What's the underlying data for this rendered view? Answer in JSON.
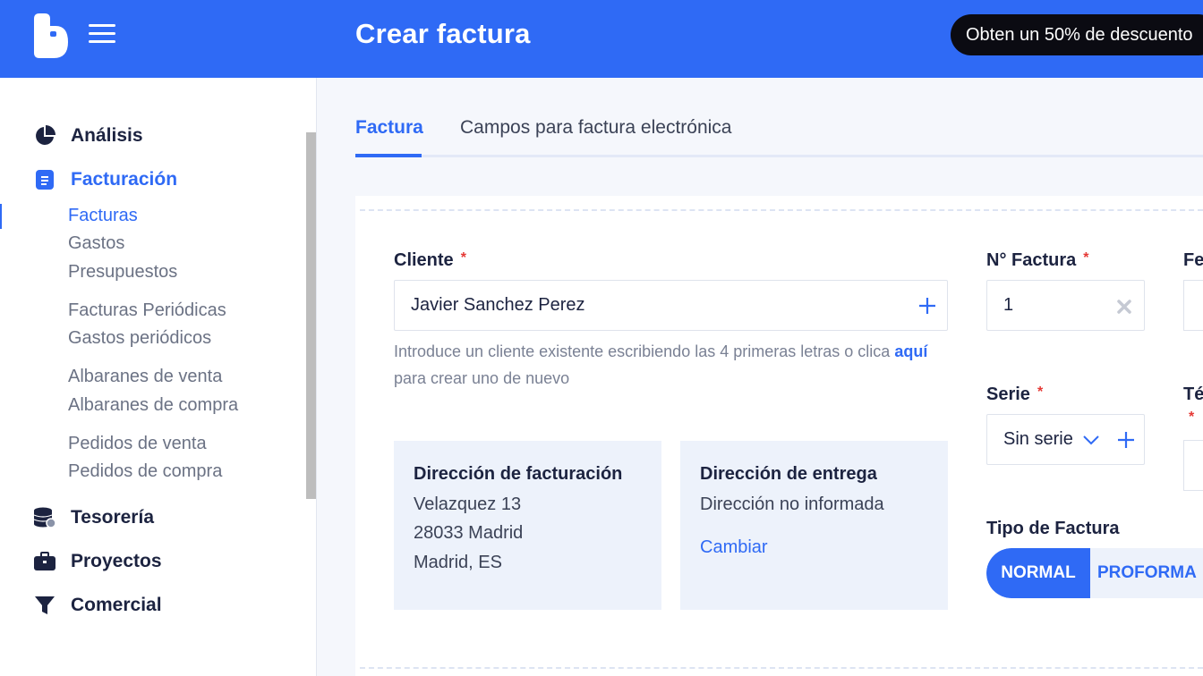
{
  "header": {
    "title": "Crear factura",
    "promo": "Obten un 50% de descuento",
    "brand_color": "#2f6af5"
  },
  "sidebar": {
    "main": [
      {
        "label": "Análisis",
        "icon": "pie-chart-icon"
      },
      {
        "label": "Facturación",
        "icon": "invoice-icon",
        "active": true
      },
      {
        "label": "Tesorería",
        "icon": "coins-icon"
      },
      {
        "label": "Proyectos",
        "icon": "briefcase-icon"
      },
      {
        "label": "Comercial",
        "icon": "funnel-icon"
      }
    ],
    "sub": [
      {
        "label": "Facturas",
        "active": true
      },
      {
        "label": "Gastos"
      },
      {
        "label": "Presupuestos"
      },
      {
        "label": "Facturas Periódicas"
      },
      {
        "label": "Gastos periódicos"
      },
      {
        "label": "Albaranes de venta"
      },
      {
        "label": "Albaranes de compra"
      },
      {
        "label": "Pedidos de venta"
      },
      {
        "label": "Pedidos de compra"
      }
    ]
  },
  "tabs": [
    {
      "label": "Factura",
      "active": true
    },
    {
      "label": "Campos para factura electrónica"
    }
  ],
  "form": {
    "cliente": {
      "label": "Cliente",
      "required": "*",
      "value": "Javier Sanchez Perez",
      "help": "Introduce un cliente existente escribiendo las 4 primeras letras o clica",
      "help_link": "aquí",
      "help_end": "para crear uno de nuevo"
    },
    "numero": {
      "label": "N° Factura",
      "required": "*",
      "value": "1"
    },
    "fecha": {
      "label": "Fe"
    },
    "serie": {
      "label": "Serie",
      "required": "*",
      "value": "Sin serie"
    },
    "terminos": {
      "label": "Té",
      "required": "*"
    },
    "tipo": {
      "label": "Tipo de Factura",
      "options": [
        "NORMAL",
        "PROFORMA"
      ],
      "selected": "NORMAL"
    },
    "facturacion": {
      "title": "Dirección de facturación",
      "lines": [
        "Velazquez 13",
        "28033 Madrid",
        "Madrid, ES"
      ]
    },
    "entrega": {
      "title": "Dirección de entrega",
      "line": "Dirección no informada",
      "link": "Cambiar"
    }
  }
}
